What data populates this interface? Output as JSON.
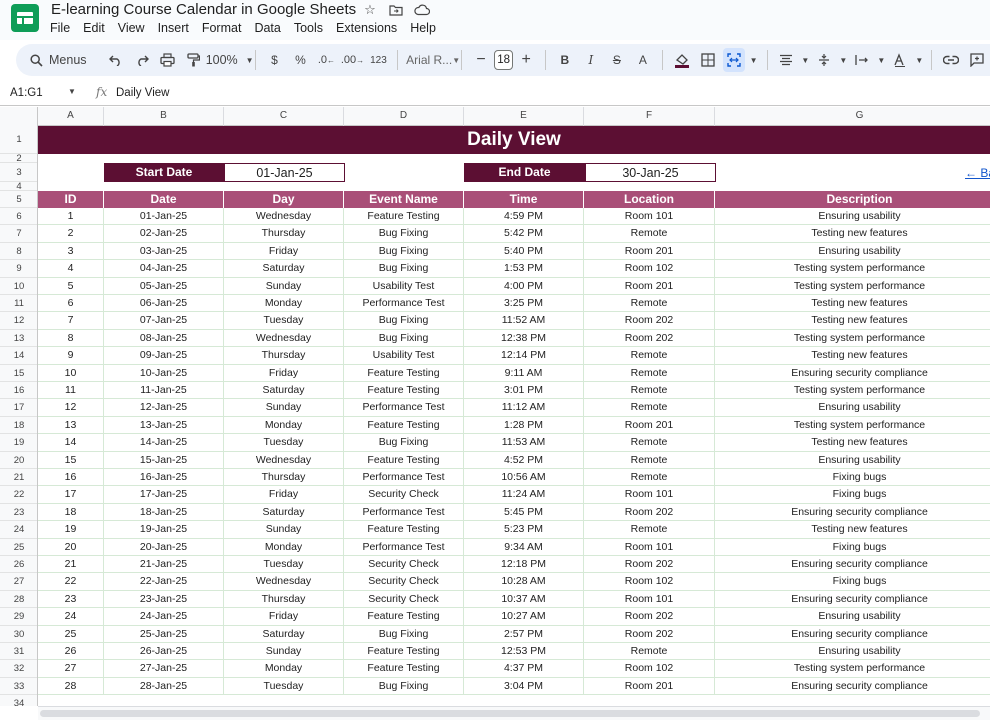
{
  "app": {
    "title": "E-learning Course Calendar in Google Sheets",
    "menu": [
      "File",
      "Edit",
      "View",
      "Insert",
      "Format",
      "Data",
      "Tools",
      "Extensions",
      "Help"
    ]
  },
  "toolbar": {
    "menus_label": "Menus",
    "zoom": "100%",
    "currency": "$",
    "percent": "%",
    "dec_decrease": ".0",
    "dec_increase": ".00",
    "number_format": "123",
    "font": "Arial R...",
    "font_size": "18",
    "bold": "B",
    "italic": "I",
    "strike": "S",
    "text_color": "A"
  },
  "formula_bar": {
    "name_box": "A1:G1",
    "fx": "fx",
    "content": "Daily View"
  },
  "columns": [
    "A",
    "B",
    "C",
    "D",
    "E",
    "F",
    "G"
  ],
  "row_numbers": [
    "1",
    "2",
    "3",
    "4",
    "5",
    "6",
    "7",
    "8",
    "9",
    "10",
    "11",
    "12",
    "13",
    "14",
    "15",
    "16",
    "17",
    "18",
    "19",
    "20",
    "21",
    "22",
    "23",
    "24",
    "25",
    "26",
    "27",
    "28",
    "29",
    "30",
    "31",
    "32",
    "33",
    "34"
  ],
  "sheet": {
    "title": "Daily View",
    "start_label": "Start Date",
    "start_value": "01-Jan-25",
    "end_label": "End Date",
    "end_value": "30-Jan-25",
    "back_link": "← Ba",
    "headers": [
      "ID",
      "Date",
      "Day",
      "Event Name",
      "Time",
      "Location",
      "Description"
    ],
    "rows": [
      [
        "1",
        "01-Jan-25",
        "Wednesday",
        "Feature Testing",
        "4:59 PM",
        "Room 101",
        "Ensuring usability"
      ],
      [
        "2",
        "02-Jan-25",
        "Thursday",
        "Bug Fixing",
        "5:42 PM",
        "Remote",
        "Testing new features"
      ],
      [
        "3",
        "03-Jan-25",
        "Friday",
        "Bug Fixing",
        "5:40 PM",
        "Room 201",
        "Ensuring usability"
      ],
      [
        "4",
        "04-Jan-25",
        "Saturday",
        "Bug Fixing",
        "1:53 PM",
        "Room 102",
        "Testing system performance"
      ],
      [
        "5",
        "05-Jan-25",
        "Sunday",
        "Usability Test",
        "4:00 PM",
        "Room 201",
        "Testing system performance"
      ],
      [
        "6",
        "06-Jan-25",
        "Monday",
        "Performance Test",
        "3:25 PM",
        "Remote",
        "Testing new features"
      ],
      [
        "7",
        "07-Jan-25",
        "Tuesday",
        "Bug Fixing",
        "11:52 AM",
        "Room 202",
        "Testing new features"
      ],
      [
        "8",
        "08-Jan-25",
        "Wednesday",
        "Bug Fixing",
        "12:38 PM",
        "Room 202",
        "Testing system performance"
      ],
      [
        "9",
        "09-Jan-25",
        "Thursday",
        "Usability Test",
        "12:14 PM",
        "Remote",
        "Testing new features"
      ],
      [
        "10",
        "10-Jan-25",
        "Friday",
        "Feature Testing",
        "9:11 AM",
        "Remote",
        "Ensuring security compliance"
      ],
      [
        "11",
        "11-Jan-25",
        "Saturday",
        "Feature Testing",
        "3:01 PM",
        "Remote",
        "Testing system performance"
      ],
      [
        "12",
        "12-Jan-25",
        "Sunday",
        "Performance Test",
        "11:12 AM",
        "Remote",
        "Ensuring usability"
      ],
      [
        "13",
        "13-Jan-25",
        "Monday",
        "Feature Testing",
        "1:28 PM",
        "Room 201",
        "Testing system performance"
      ],
      [
        "14",
        "14-Jan-25",
        "Tuesday",
        "Bug Fixing",
        "11:53 AM",
        "Remote",
        "Testing new features"
      ],
      [
        "15",
        "15-Jan-25",
        "Wednesday",
        "Feature Testing",
        "4:52 PM",
        "Remote",
        "Ensuring usability"
      ],
      [
        "16",
        "16-Jan-25",
        "Thursday",
        "Performance Test",
        "10:56 AM",
        "Remote",
        "Fixing bugs"
      ],
      [
        "17",
        "17-Jan-25",
        "Friday",
        "Security Check",
        "11:24 AM",
        "Room 101",
        "Fixing bugs"
      ],
      [
        "18",
        "18-Jan-25",
        "Saturday",
        "Performance Test",
        "5:45 PM",
        "Room 202",
        "Ensuring security compliance"
      ],
      [
        "19",
        "19-Jan-25",
        "Sunday",
        "Feature Testing",
        "5:23 PM",
        "Remote",
        "Testing new features"
      ],
      [
        "20",
        "20-Jan-25",
        "Monday",
        "Performance Test",
        "9:34 AM",
        "Room 101",
        "Fixing bugs"
      ],
      [
        "21",
        "21-Jan-25",
        "Tuesday",
        "Security Check",
        "12:18 PM",
        "Room 202",
        "Ensuring security compliance"
      ],
      [
        "22",
        "22-Jan-25",
        "Wednesday",
        "Security Check",
        "10:28 AM",
        "Room 102",
        "Fixing bugs"
      ],
      [
        "23",
        "23-Jan-25",
        "Thursday",
        "Security Check",
        "10:37 AM",
        "Room 101",
        "Ensuring security compliance"
      ],
      [
        "24",
        "24-Jan-25",
        "Friday",
        "Feature Testing",
        "10:27 AM",
        "Room 202",
        "Ensuring usability"
      ],
      [
        "25",
        "25-Jan-25",
        "Saturday",
        "Bug Fixing",
        "2:57 PM",
        "Room 202",
        "Ensuring security compliance"
      ],
      [
        "26",
        "26-Jan-25",
        "Sunday",
        "Feature Testing",
        "12:53 PM",
        "Remote",
        "Ensuring usability"
      ],
      [
        "27",
        "27-Jan-25",
        "Monday",
        "Feature Testing",
        "4:37 PM",
        "Room 102",
        "Testing system performance"
      ],
      [
        "28",
        "28-Jan-25",
        "Tuesday",
        "Bug Fixing",
        "3:04 PM",
        "Room 201",
        "Ensuring security compliance"
      ]
    ]
  },
  "colors": {
    "title_band": "#5c0f33",
    "table_header": "#a94f78",
    "grid_line": "#d6e9d6",
    "toolbar_bg": "#edf2fa"
  }
}
